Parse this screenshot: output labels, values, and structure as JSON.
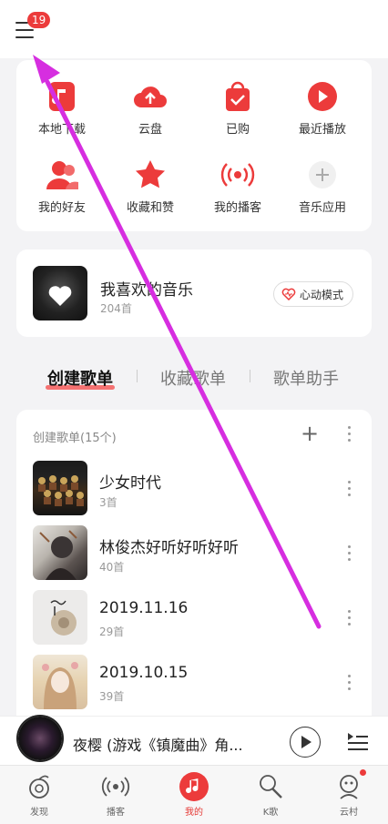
{
  "header": {
    "notification_count": "19"
  },
  "quick_grid": [
    {
      "label": "本地下载",
      "icon": "music-file-icon"
    },
    {
      "label": "云盘",
      "icon": "cloud-upload-icon"
    },
    {
      "label": "已购",
      "icon": "shopping-bag-icon"
    },
    {
      "label": "最近播放",
      "icon": "play-circle-icon"
    },
    {
      "label": "我的好友",
      "icon": "friends-icon"
    },
    {
      "label": "收藏和赞",
      "icon": "star-icon"
    },
    {
      "label": "我的播客",
      "icon": "broadcast-icon"
    },
    {
      "label": "音乐应用",
      "icon": "plus-icon"
    }
  ],
  "favorites": {
    "title": "我喜欢的音乐",
    "count": "204首",
    "heart_mode_label": "心动模式"
  },
  "tabs": [
    {
      "label": "创建歌单",
      "active": true
    },
    {
      "label": "收藏歌单",
      "active": false
    },
    {
      "label": "歌单助手",
      "active": false
    }
  ],
  "created_playlists": {
    "header": "创建歌单(15个)",
    "items": [
      {
        "title": "少女时代",
        "count": "3首"
      },
      {
        "title": "林俊杰好听好听好听",
        "count": "40首"
      },
      {
        "title": "2019.11.16",
        "count": "29首"
      },
      {
        "title": "2019.10.15",
        "count": "39首"
      }
    ]
  },
  "now_playing": {
    "title": "夜樱 (游戏《镇魔曲》角..."
  },
  "bottom_nav": [
    {
      "label": "发现",
      "active": false
    },
    {
      "label": "播客",
      "active": false
    },
    {
      "label": "我的",
      "active": true
    },
    {
      "label": "K歌",
      "active": false
    },
    {
      "label": "云村",
      "active": false
    }
  ],
  "colors": {
    "accent": "#ec3b3b",
    "annotation_arrow": "#d62ee0"
  }
}
